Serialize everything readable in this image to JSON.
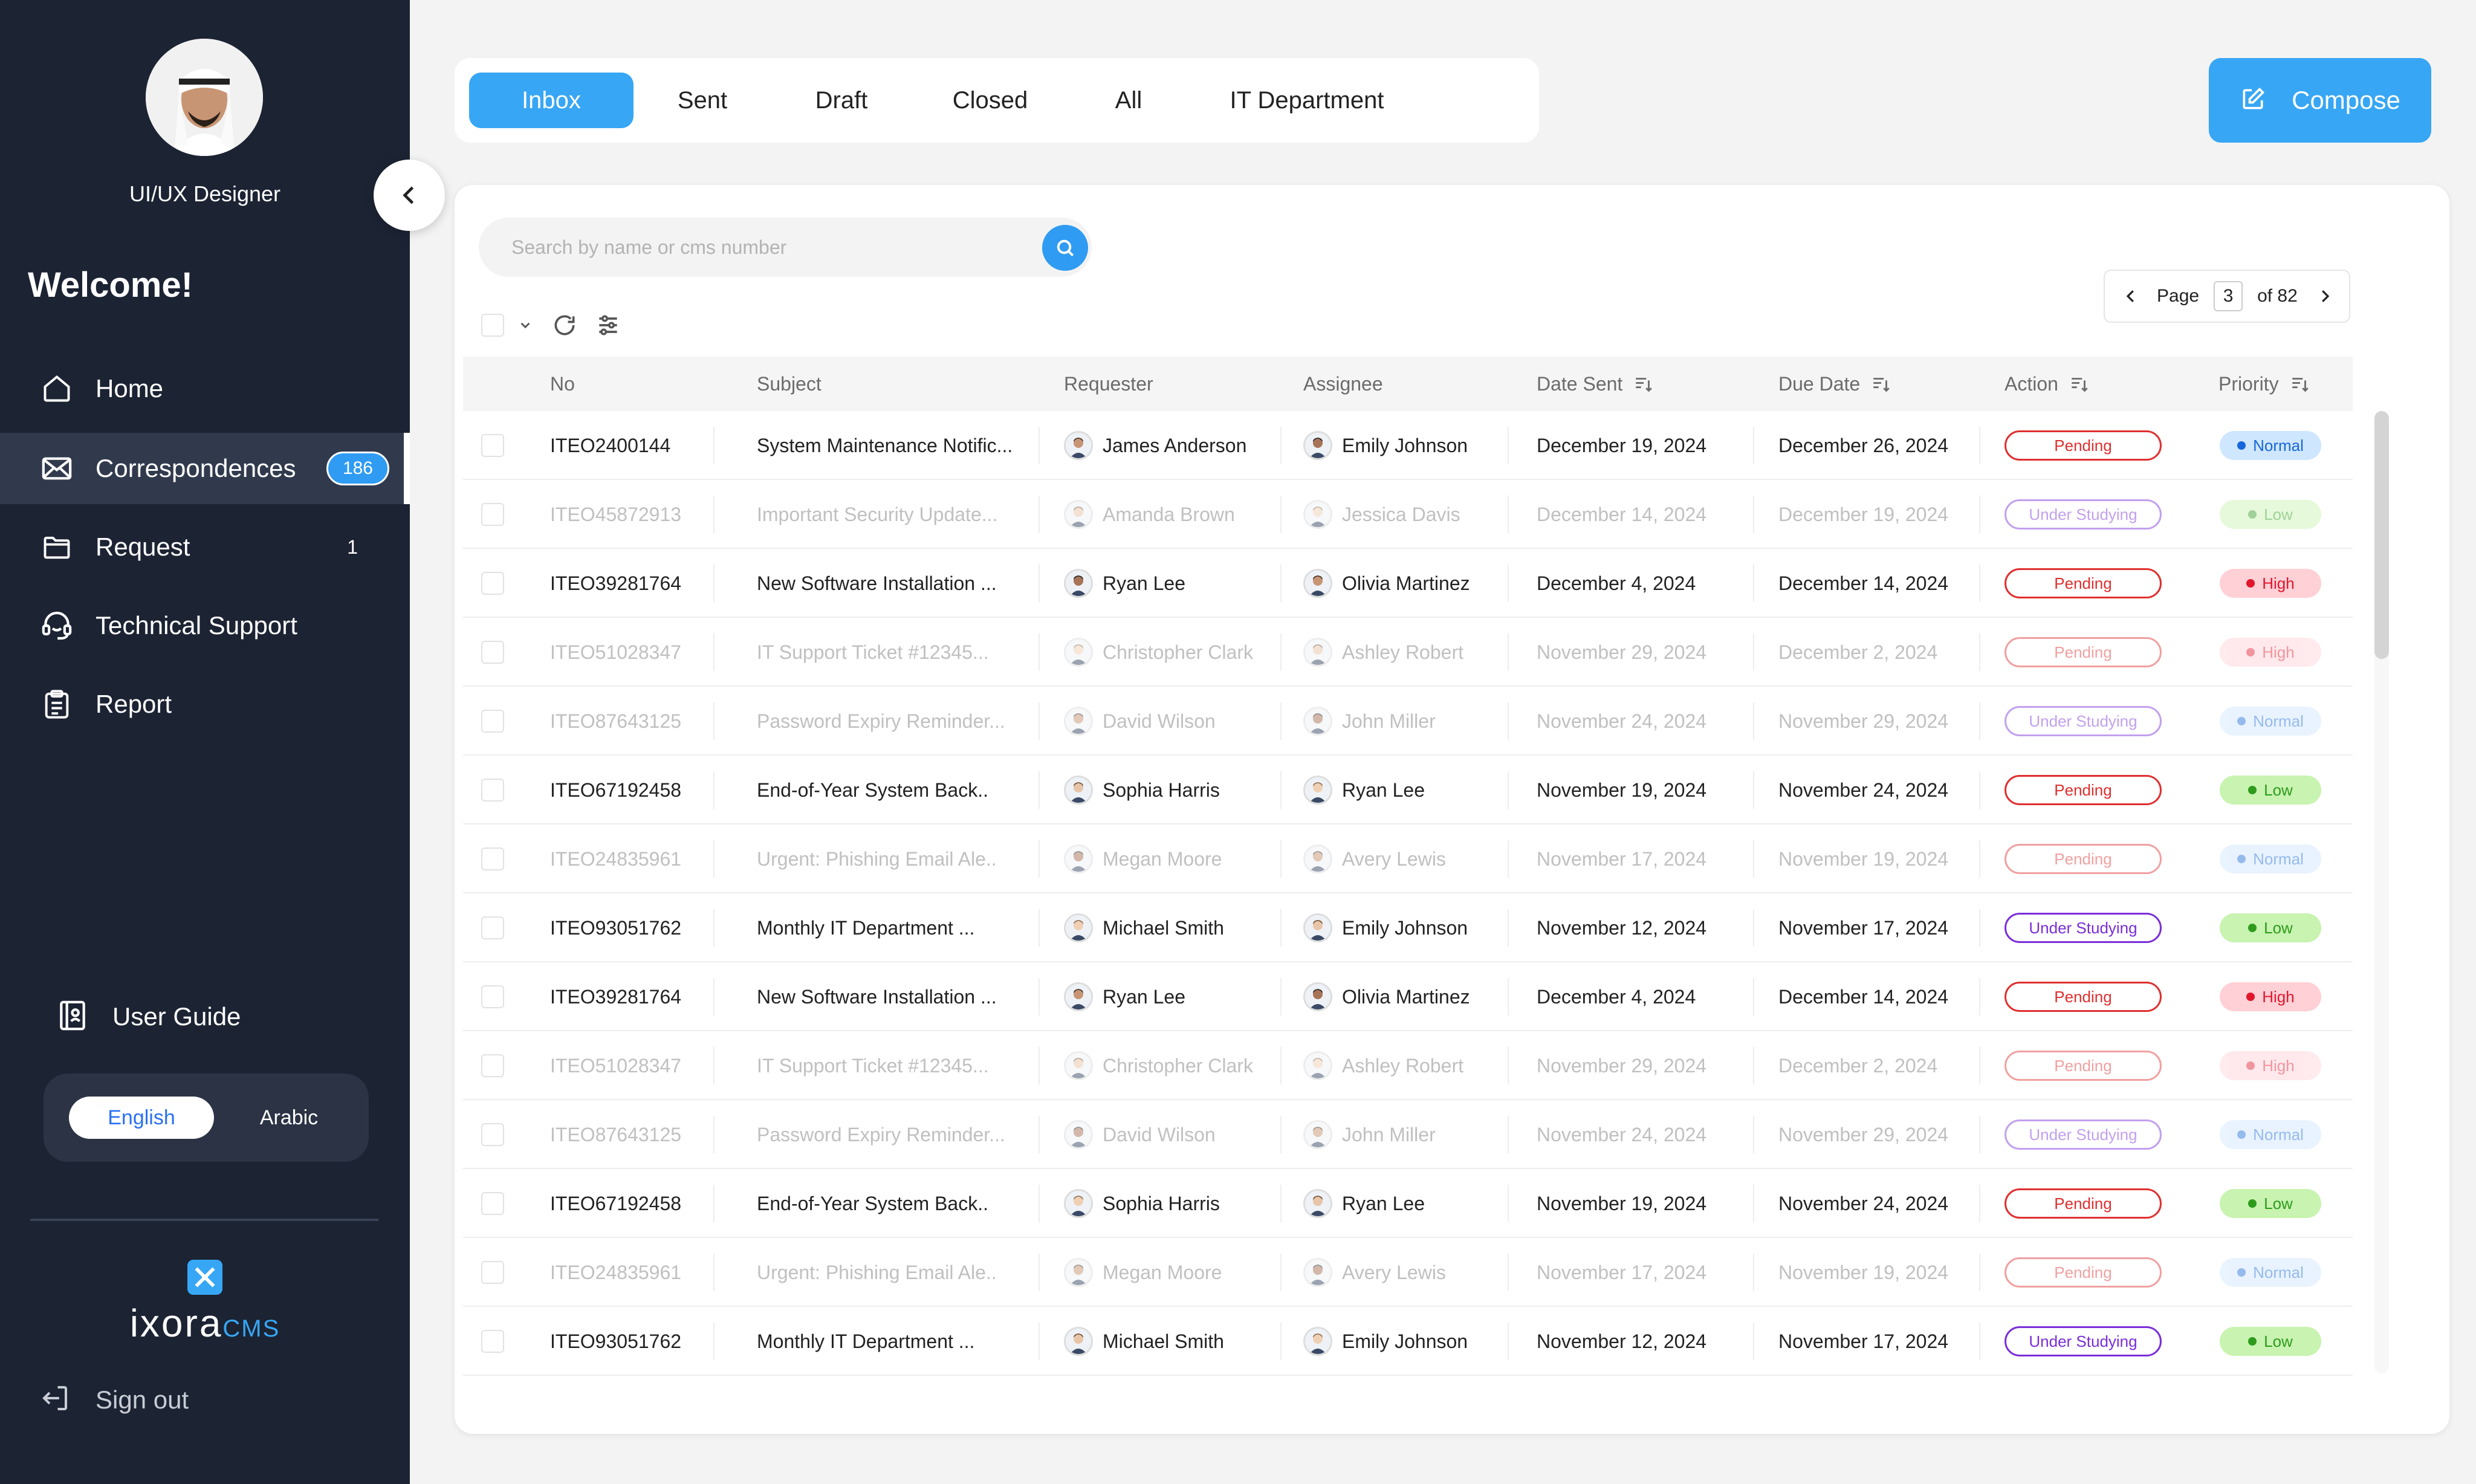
{
  "user": {
    "role": "UI/UX Designer"
  },
  "sidebar": {
    "welcome": "Welcome!",
    "nav": [
      {
        "label": "Home",
        "icon": "home-icon"
      },
      {
        "label": "Correspondences",
        "icon": "mail-icon",
        "badge": "186"
      },
      {
        "label": "Request",
        "icon": "folder-icon",
        "count": "1"
      },
      {
        "label": "Technical Support",
        "icon": "headset-icon"
      },
      {
        "label": "Report",
        "icon": "clipboard-icon"
      }
    ],
    "user_guide": "User Guide",
    "languages": [
      "English",
      "Arabic"
    ],
    "active_language": "English",
    "brand": {
      "name": "ixora",
      "suffix": "CMS"
    },
    "sign_out": "Sign out"
  },
  "tabs": [
    "Inbox",
    "Sent",
    "Draft",
    "Closed",
    "All",
    "IT Department"
  ],
  "active_tab": "Inbox",
  "compose_label": "Compose",
  "search": {
    "placeholder": "Search by name or cms number"
  },
  "pagination": {
    "label": "Page",
    "current": "3",
    "of": "of 82"
  },
  "table": {
    "columns": [
      "No",
      "Subject",
      "Requester",
      "Assignee",
      "Date Sent",
      "Due Date",
      "Action",
      "Priority"
    ],
    "rows": [
      {
        "no": "ITEO2400144",
        "subject": "System Maintenance Notific...",
        "requester": "James Anderson",
        "assignee": "Emily Johnson",
        "date_sent": "December 19, 2024",
        "due_date": "December 26, 2024",
        "action": "Pending",
        "priority": "Normal",
        "read": false
      },
      {
        "no": "ITEO45872913",
        "subject": "Important Security Update...",
        "requester": "Amanda Brown",
        "assignee": "Jessica Davis",
        "date_sent": "December 14, 2024",
        "due_date": "December 19, 2024",
        "action": "Under Studying",
        "priority": "Low",
        "read": true
      },
      {
        "no": "ITEO39281764",
        "subject": "New Software Installation ...",
        "requester": "Ryan Lee",
        "assignee": "Olivia Martinez",
        "date_sent": "December 4, 2024",
        "due_date": "December 14, 2024",
        "action": "Pending",
        "priority": "High",
        "read": false
      },
      {
        "no": "ITEO51028347",
        "subject": "IT Support Ticket #12345...",
        "requester": "Christopher Clark",
        "assignee": "Ashley Robert",
        "date_sent": "November 29, 2024",
        "due_date": "December 2, 2024",
        "action": "Pending",
        "priority": "High",
        "read": true
      },
      {
        "no": "ITEO87643125",
        "subject": "Password Expiry Reminder...",
        "requester": "David Wilson",
        "assignee": "John Miller",
        "date_sent": "November 24, 2024",
        "due_date": "November 29, 2024",
        "action": "Under Studying",
        "priority": "Normal",
        "read": true
      },
      {
        "no": "ITEO67192458",
        "subject": "End-of-Year System Back..",
        "requester": "Sophia Harris",
        "assignee": "Ryan Lee",
        "date_sent": "November 19, 2024",
        "due_date": "November 24, 2024",
        "action": "Pending",
        "priority": "Low",
        "read": false
      },
      {
        "no": "ITEO24835961",
        "subject": "Urgent: Phishing Email Ale..",
        "requester": "Megan Moore",
        "assignee": "Avery Lewis",
        "date_sent": "November 17, 2024",
        "due_date": "November 19, 2024",
        "action": "Pending",
        "priority": "Normal",
        "read": true
      },
      {
        "no": "ITEO93051762",
        "subject": "Monthly IT Department ...",
        "requester": "Michael Smith",
        "assignee": "Emily Johnson",
        "date_sent": "November 12, 2024",
        "due_date": "November 17, 2024",
        "action": "Under Studying",
        "priority": "Low",
        "read": false
      },
      {
        "no": "ITEO39281764",
        "subject": "New Software Installation ...",
        "requester": "Ryan Lee",
        "assignee": "Olivia Martinez",
        "date_sent": "December 4, 2024",
        "due_date": "December 14, 2024",
        "action": "Pending",
        "priority": "High",
        "read": false
      },
      {
        "no": "ITEO51028347",
        "subject": "IT Support Ticket #12345...",
        "requester": "Christopher Clark",
        "assignee": "Ashley Robert",
        "date_sent": "November 29, 2024",
        "due_date": "December 2, 2024",
        "action": "Pending",
        "priority": "High",
        "read": true
      },
      {
        "no": "ITEO87643125",
        "subject": "Password Expiry Reminder...",
        "requester": "David Wilson",
        "assignee": "John Miller",
        "date_sent": "November 24, 2024",
        "due_date": "November 29, 2024",
        "action": "Under Studying",
        "priority": "Normal",
        "read": true
      },
      {
        "no": "ITEO67192458",
        "subject": "End-of-Year System Back..",
        "requester": "Sophia Harris",
        "assignee": "Ryan Lee",
        "date_sent": "November 19, 2024",
        "due_date": "November 24, 2024",
        "action": "Pending",
        "priority": "Low",
        "read": false
      },
      {
        "no": "ITEO24835961",
        "subject": "Urgent: Phishing Email Ale..",
        "requester": "Megan Moore",
        "assignee": "Avery Lewis",
        "date_sent": "November 17, 2024",
        "due_date": "November 19, 2024",
        "action": "Pending",
        "priority": "Normal",
        "read": true
      },
      {
        "no": "ITEO93051762",
        "subject": "Monthly IT Department ...",
        "requester": "Michael Smith",
        "assignee": "Emily Johnson",
        "date_sent": "November 12, 2024",
        "due_date": "November 17, 2024",
        "action": "Under Studying",
        "priority": "Low",
        "read": false
      }
    ]
  },
  "colors": {
    "sidebar_bg": "#1c2333",
    "accent": "#37a6f5",
    "pending": "#e02f2f",
    "under_studying": "#7a2ed8",
    "priority_normal_bg": "#cfe6ff",
    "priority_normal_dot": "#1667d9",
    "priority_low_bg": "#c8f3b0",
    "priority_low_dot": "#2e9b1d",
    "priority_high_bg": "#ffd0d6",
    "priority_high_dot": "#e0172c"
  }
}
